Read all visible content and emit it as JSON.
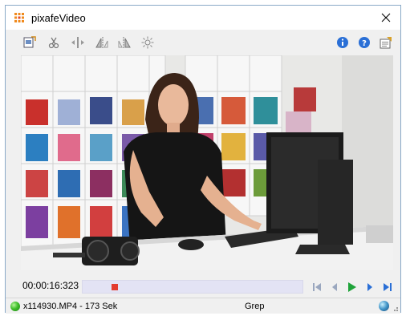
{
  "window": {
    "title": "pixafeVideo",
    "title_icon": "app-grid-icon",
    "close_icon": "close-icon"
  },
  "toolbar": {
    "left_tools": [
      {
        "name": "open-file-icon"
      },
      {
        "name": "cut-icon"
      },
      {
        "name": "split-icon"
      },
      {
        "name": "mirror-left-icon"
      },
      {
        "name": "mirror-right-icon"
      },
      {
        "name": "effects-icon"
      }
    ],
    "right_tools": [
      {
        "name": "info-icon"
      },
      {
        "name": "help-icon"
      },
      {
        "name": "settings-icon"
      }
    ]
  },
  "video": {
    "description_icon": "video-frame"
  },
  "player": {
    "time": "00:00:16:323",
    "progress": 0.094,
    "buttons": [
      {
        "name": "skip-to-start-icon"
      },
      {
        "name": "step-back-icon"
      },
      {
        "name": "play-icon"
      },
      {
        "name": "step-forward-icon"
      },
      {
        "name": "skip-to-end-icon"
      }
    ]
  },
  "status": {
    "file": "x114930.MP4 - 173 Sek",
    "middle": "Grep"
  },
  "colors": {
    "accent_blue": "#2a6fd6",
    "play_green": "#1fa33a",
    "seek_thumb": "#e33b2f",
    "seek_track": "#e3e3f4"
  }
}
